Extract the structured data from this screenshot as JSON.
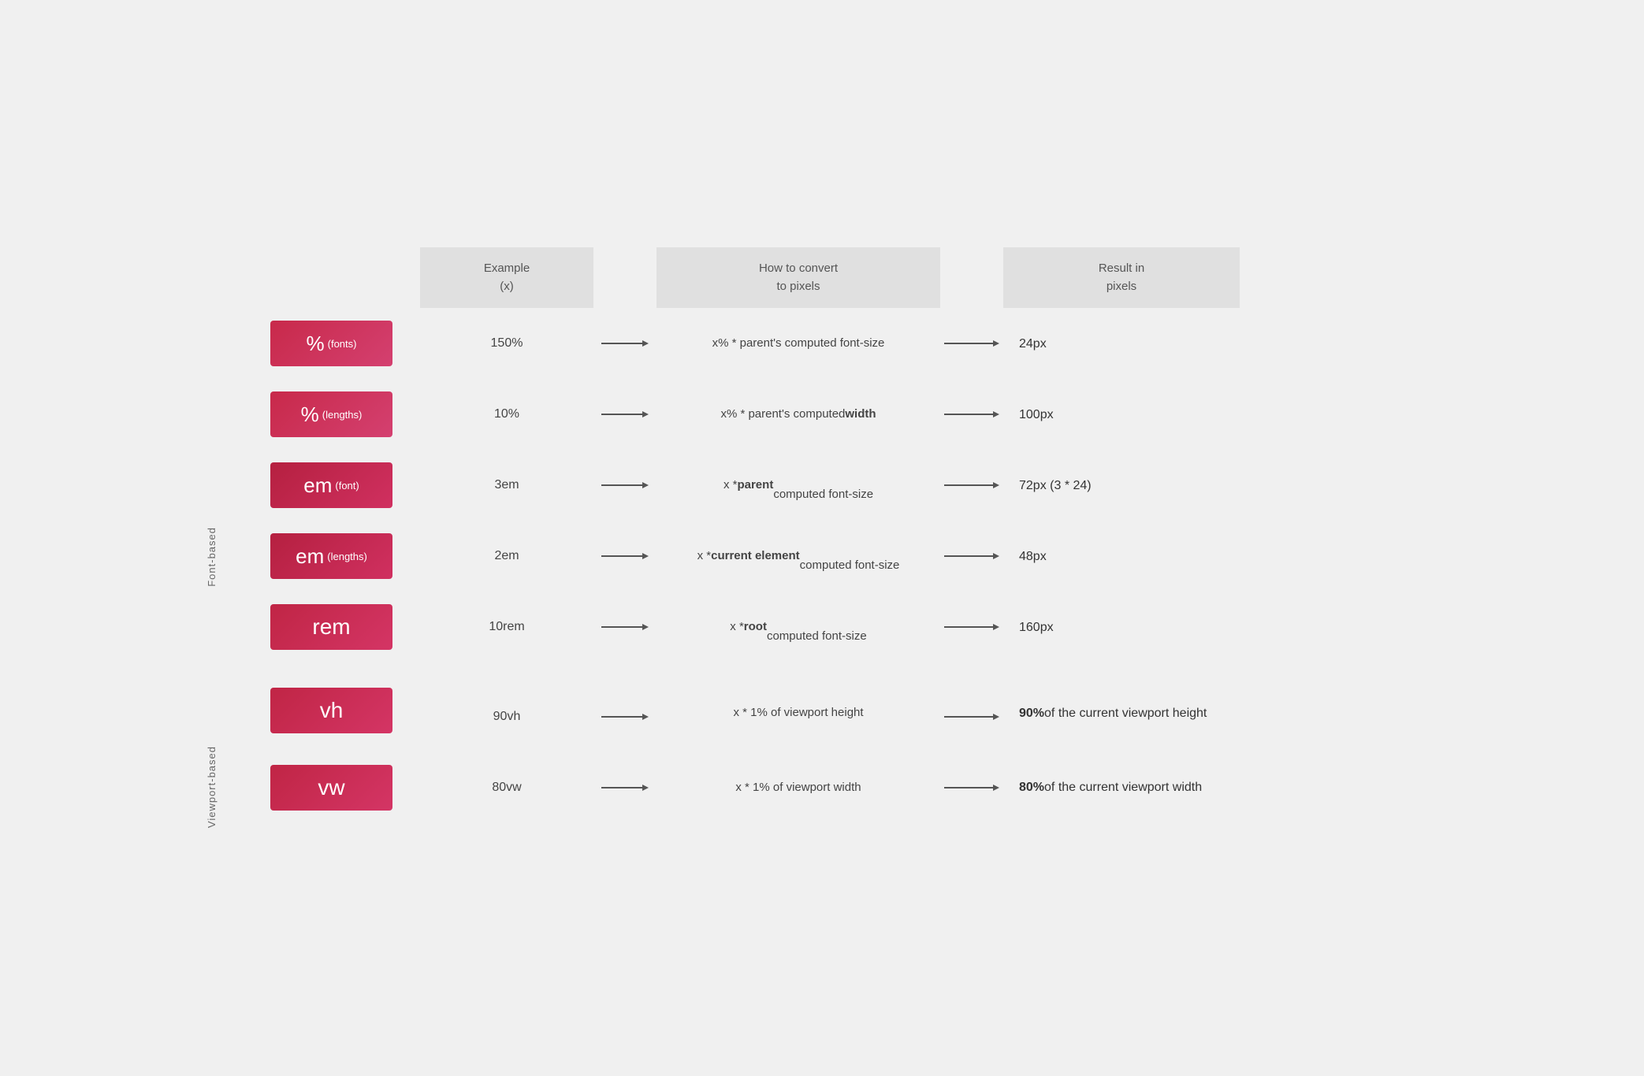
{
  "header": {
    "col1_empty": "",
    "col2_empty": "",
    "col3": "Example\n(x)",
    "col4_empty": "",
    "col5": "How to convert\nto pixels",
    "col6_empty": "",
    "col7": "Result in\npixels"
  },
  "groups": [
    {
      "name": "Font-based",
      "rows": [
        {
          "unit": "%",
          "unit_sub": "(fonts)",
          "example": "150%",
          "convert": "x% * parent's computed font-size",
          "convert_bold": "",
          "result": "24px",
          "result_bold": ""
        },
        {
          "unit": "%",
          "unit_sub": "(lengths)",
          "example": "10%",
          "convert_pre": "x% * parent's computed ",
          "convert_bold": "width",
          "convert_post": "",
          "result": "100px",
          "result_bold": ""
        },
        {
          "unit": "em",
          "unit_sub": "(font)",
          "example": "3em",
          "convert_pre": "x * ",
          "convert_bold": "parent",
          "convert_post": " computed font-size",
          "result": "72px (3 * 24)",
          "result_bold": ""
        },
        {
          "unit": "em",
          "unit_sub": "(lengths)",
          "example": "2em",
          "convert_pre": "x * ",
          "convert_bold": "current element",
          "convert_post": " computed font-size",
          "result": "48px",
          "result_bold": ""
        },
        {
          "unit": "rem",
          "unit_sub": "",
          "example": "10rem",
          "convert_pre": "x * ",
          "convert_bold": "root",
          "convert_post": " computed font-size",
          "result": "160px",
          "result_bold": ""
        }
      ]
    },
    {
      "name": "Viewport-based",
      "rows": [
        {
          "unit": "vh",
          "unit_sub": "",
          "example": "90vh",
          "convert_pre": "x * 1% of viewport height",
          "convert_bold": "",
          "convert_post": "",
          "result_pre": "",
          "result_bold": "90%",
          "result_post": " of the current viewport height"
        },
        {
          "unit": "vw",
          "unit_sub": "",
          "example": "80vw",
          "convert_pre": "x * 1% of viewport width",
          "convert_bold": "",
          "convert_post": "",
          "result_pre": "",
          "result_bold": "80%",
          "result_post": " of the current viewport width"
        }
      ]
    }
  ],
  "badge_gradient_start": "#c8294a",
  "badge_gradient_end": "#d44070"
}
